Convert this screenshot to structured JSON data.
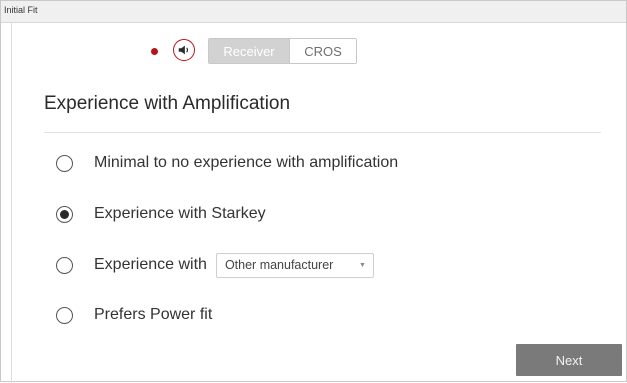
{
  "window": {
    "title": "Initial Fit"
  },
  "toolbar": {
    "ear_indicator": {
      "color": "#b5121b"
    },
    "speaker_icon": "speaker-icon",
    "segments": [
      {
        "label": "Receiver",
        "selected": true
      },
      {
        "label": "CROS",
        "selected": false
      }
    ]
  },
  "section": {
    "title": "Experience with Amplification",
    "options": [
      {
        "label": "Minimal to no experience with amplification",
        "selected": false
      },
      {
        "label": "Experience with Starkey",
        "selected": true
      },
      {
        "label": "Experience with",
        "selected": false,
        "dropdown": {
          "value": "Other manufacturer"
        }
      },
      {
        "label": "Prefers Power fit",
        "selected": false
      }
    ]
  },
  "footer": {
    "next_label": "Next"
  },
  "colors": {
    "accent": "#b5121b",
    "button": "#7a7a7a",
    "segment_active": "#d2d2d2"
  }
}
